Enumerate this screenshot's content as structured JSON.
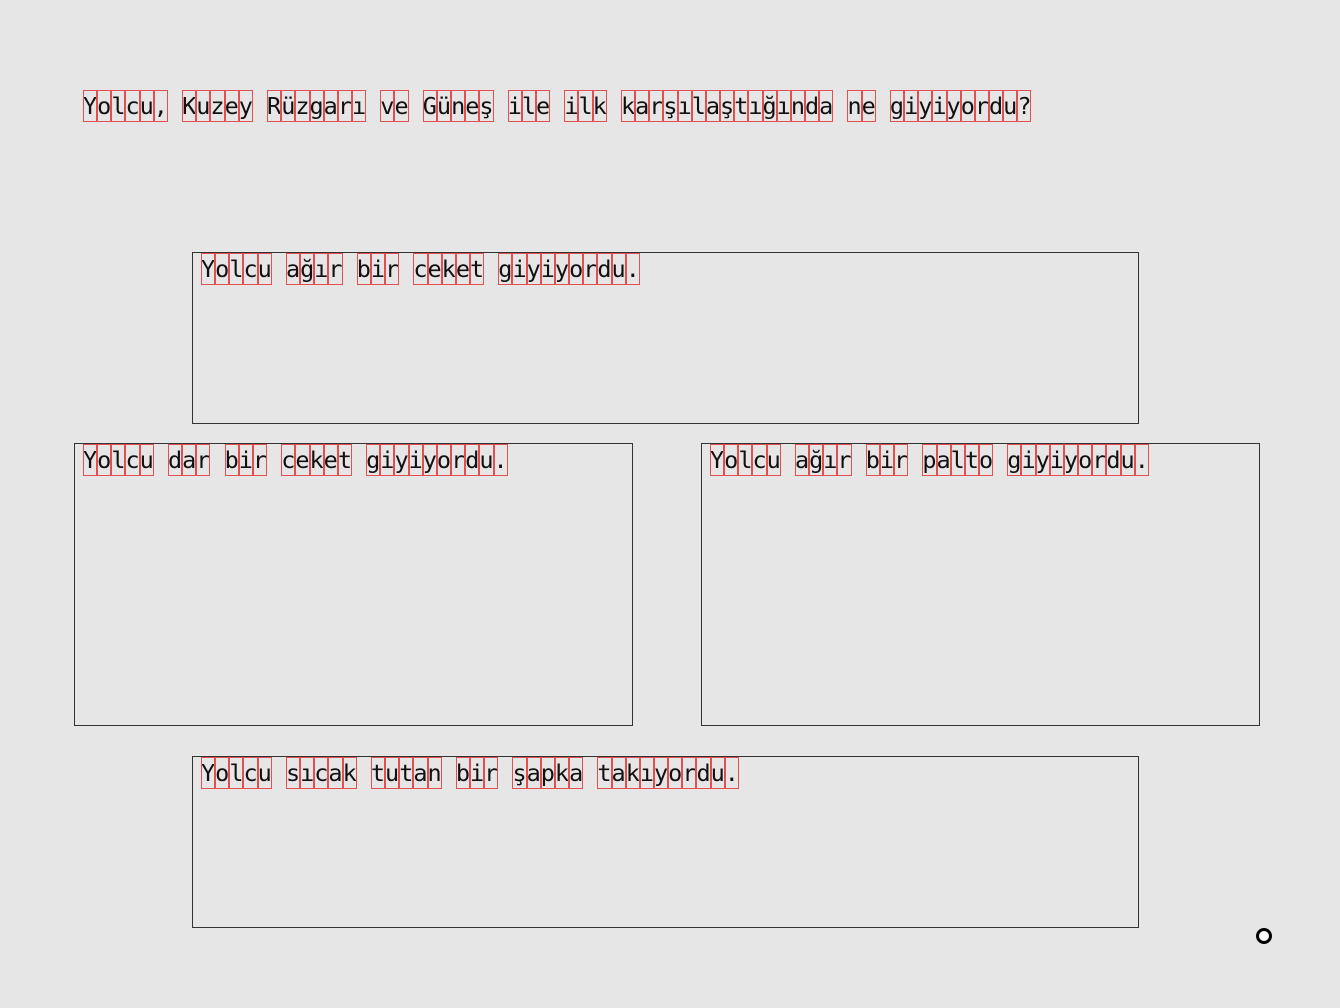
{
  "question": "Yolcu, Kuzey Rüzgarı ve Güneş ile ilk karşılaştığında ne giyiyordu?",
  "options": [
    "Yolcu ağır bir ceket giyiyordu.",
    "Yolcu dar bir ceket giyiyordu.",
    "Yolcu ağır bir palto giyiyordu.",
    "Yolcu sıcak tutan bir şapka takıyordu."
  ],
  "cursor_icon": "circle-cursor-icon"
}
